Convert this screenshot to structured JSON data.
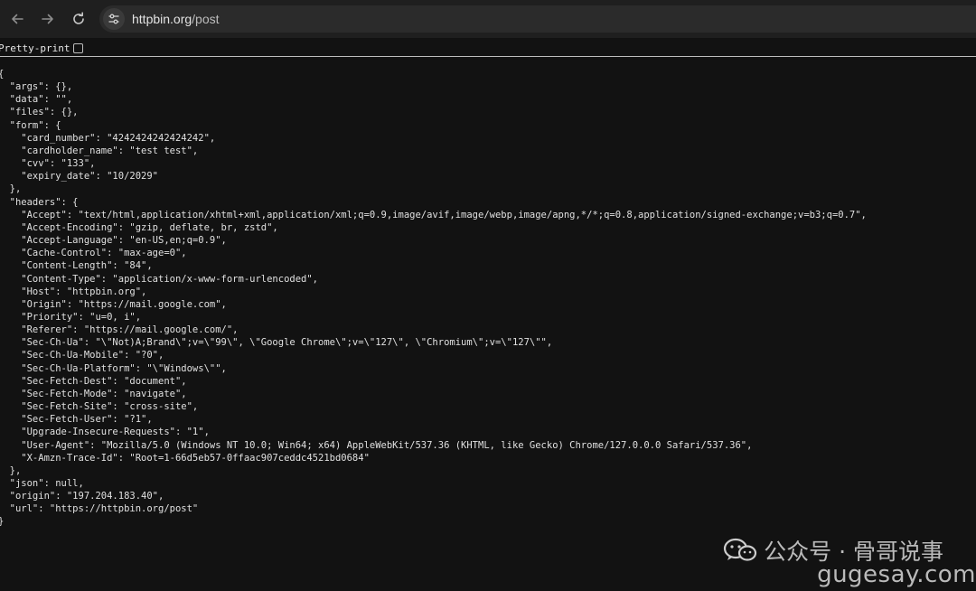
{
  "browser": {
    "url_host": "httpbin.org",
    "url_path": "/post"
  },
  "viewer": {
    "pretty_print_label": "Pretty-print",
    "pretty_print_checked": false
  },
  "response_text": "{\n  \"args\": {},\n  \"data\": \"\",\n  \"files\": {},\n  \"form\": {\n    \"card_number\": \"4242424242424242\",\n    \"cardholder_name\": \"test test\",\n    \"cvv\": \"133\",\n    \"expiry_date\": \"10/2029\"\n  },\n  \"headers\": {\n    \"Accept\": \"text/html,application/xhtml+xml,application/xml;q=0.9,image/avif,image/webp,image/apng,*/*;q=0.8,application/signed-exchange;v=b3;q=0.7\",\n    \"Accept-Encoding\": \"gzip, deflate, br, zstd\",\n    \"Accept-Language\": \"en-US,en;q=0.9\",\n    \"Cache-Control\": \"max-age=0\",\n    \"Content-Length\": \"84\",\n    \"Content-Type\": \"application/x-www-form-urlencoded\",\n    \"Host\": \"httpbin.org\",\n    \"Origin\": \"https://mail.google.com\",\n    \"Priority\": \"u=0, i\",\n    \"Referer\": \"https://mail.google.com/\",\n    \"Sec-Ch-Ua\": \"\\\"Not)A;Brand\\\";v=\\\"99\\\", \\\"Google Chrome\\\";v=\\\"127\\\", \\\"Chromium\\\";v=\\\"127\\\"\",\n    \"Sec-Ch-Ua-Mobile\": \"?0\",\n    \"Sec-Ch-Ua-Platform\": \"\\\"Windows\\\"\",\n    \"Sec-Fetch-Dest\": \"document\",\n    \"Sec-Fetch-Mode\": \"navigate\",\n    \"Sec-Fetch-Site\": \"cross-site\",\n    \"Sec-Fetch-User\": \"?1\",\n    \"Upgrade-Insecure-Requests\": \"1\",\n    \"User-Agent\": \"Mozilla/5.0 (Windows NT 10.0; Win64; x64) AppleWebKit/537.36 (KHTML, like Gecko) Chrome/127.0.0.0 Safari/537.36\",\n    \"X-Amzn-Trace-Id\": \"Root=1-66d5eb57-0ffaac907ceddc4521bd0684\"\n  },\n  \"json\": null,\n  \"origin\": \"197.204.183.40\",\n  \"url\": \"https://httpbin.org/post\"\n}",
  "watermark": {
    "line1": "公众号 · 骨哥说事",
    "line2": "gugesay.com"
  },
  "icons": {
    "back": "arrow-left-icon",
    "forward": "arrow-right-icon",
    "reload": "reload-icon",
    "site_info": "tune-icon",
    "wechat": "wechat-icon"
  },
  "colors": {
    "page_background": "#121212",
    "toolbar_background": "#1f1f1f",
    "addressbar_background": "#2b2b2b",
    "text": "#e0e0e0"
  }
}
